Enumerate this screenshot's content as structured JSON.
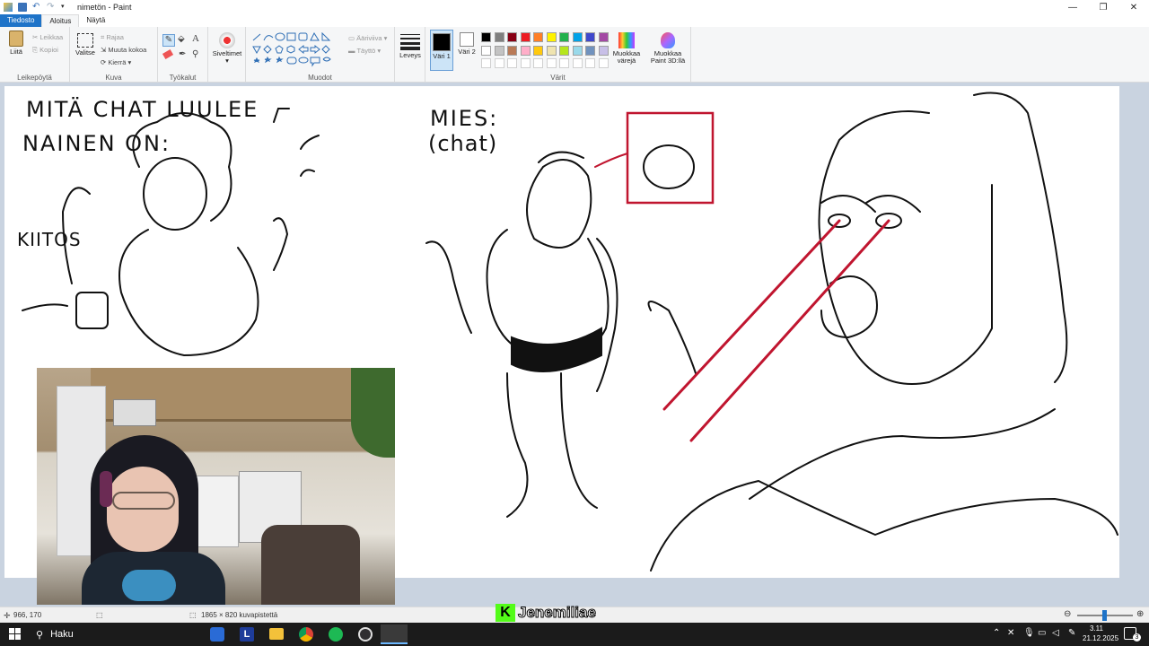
{
  "window": {
    "title": "nimetön - Paint",
    "minimize": "—",
    "maximize": "❐",
    "close": "✕"
  },
  "tabs": [
    {
      "label": "Tiedosto"
    },
    {
      "label": "Aloitus"
    },
    {
      "label": "Näytä"
    }
  ],
  "ribbon": {
    "clipboard": {
      "label": "Leikepöytä",
      "paste": "Liitä",
      "cut": "Leikkaa",
      "copy": "Kopioi"
    },
    "image": {
      "label": "Kuva",
      "select": "Valitse",
      "crop": "Rajaa",
      "resize": "Muuta kokoa",
      "rotate": "Kierrä ▾"
    },
    "tools": {
      "label": "Työkalut"
    },
    "brushes": {
      "label": "Siveltimet"
    },
    "shapes": {
      "label": "Muodot",
      "outline": "Ääriviiva ▾",
      "fill": "Täyttö ▾"
    },
    "size": {
      "label": "Leveys"
    },
    "colors": {
      "label": "Värit",
      "color1": "Väri 1",
      "color2": "Väri 2",
      "edit": "Muokkaa värejä",
      "paint3d": "Muokkaa Paint 3D:llä",
      "row1": [
        "#000000",
        "#7f7f7f",
        "#880015",
        "#ed1c24",
        "#ff7f27",
        "#fff200",
        "#22b14c",
        "#00a2e8",
        "#3f48cc",
        "#a349a4"
      ],
      "row2": [
        "#ffffff",
        "#c3c3c3",
        "#b97a57",
        "#ffaec9",
        "#ffc90e",
        "#efe4b0",
        "#b5e61d",
        "#99d9ea",
        "#7092be",
        "#c8bfe7"
      ]
    }
  },
  "drawing": {
    "text1": "MITÄ CHAT LUULEE",
    "text2": "NAINEN ON:",
    "text3": "KIITOS",
    "text4": "MIES:",
    "text5": "(chat)"
  },
  "status": {
    "cursor": "966, 170",
    "size": "1865 × 820 kuvapistettä"
  },
  "watermark": {
    "text": "Jenemiliae"
  },
  "taskbar": {
    "search": "Haku",
    "time": "3.11",
    "date": "21.12.2025",
    "notif": "3"
  }
}
